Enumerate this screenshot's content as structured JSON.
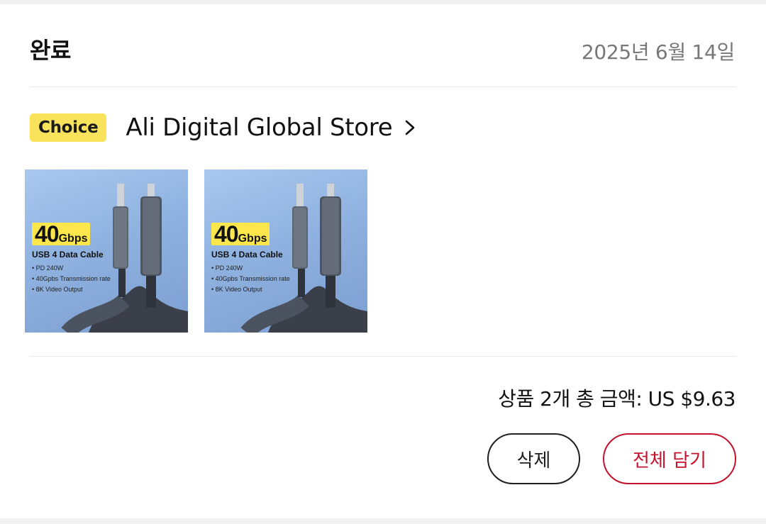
{
  "order": {
    "status": "완료",
    "date": "2025년 6월 14일",
    "store": {
      "badge": "Choice",
      "name": "Ali Digital Global Store",
      "chevron_icon": "chevron-right-icon"
    },
    "products": [
      {
        "speed_number": "40",
        "speed_unit": "Gbps",
        "title": "USB 4 Data Cable",
        "features": [
          "PD 240W",
          "40Gpbs Transmission rate",
          "8K Video Output"
        ]
      },
      {
        "speed_number": "40",
        "speed_unit": "Gbps",
        "title": "USB 4 Data Cable",
        "features": [
          "PD 240W",
          "40Gpbs Transmission rate",
          "8K Video Output"
        ]
      }
    ],
    "total_text": "상품 2개 총 금액: US $9.63",
    "buttons": {
      "delete": "삭제",
      "add_all": "전체 담기"
    }
  },
  "colors": {
    "choice_badge": "#f9e35a",
    "accent_red": "#c4122c",
    "date_gray": "#777777"
  }
}
